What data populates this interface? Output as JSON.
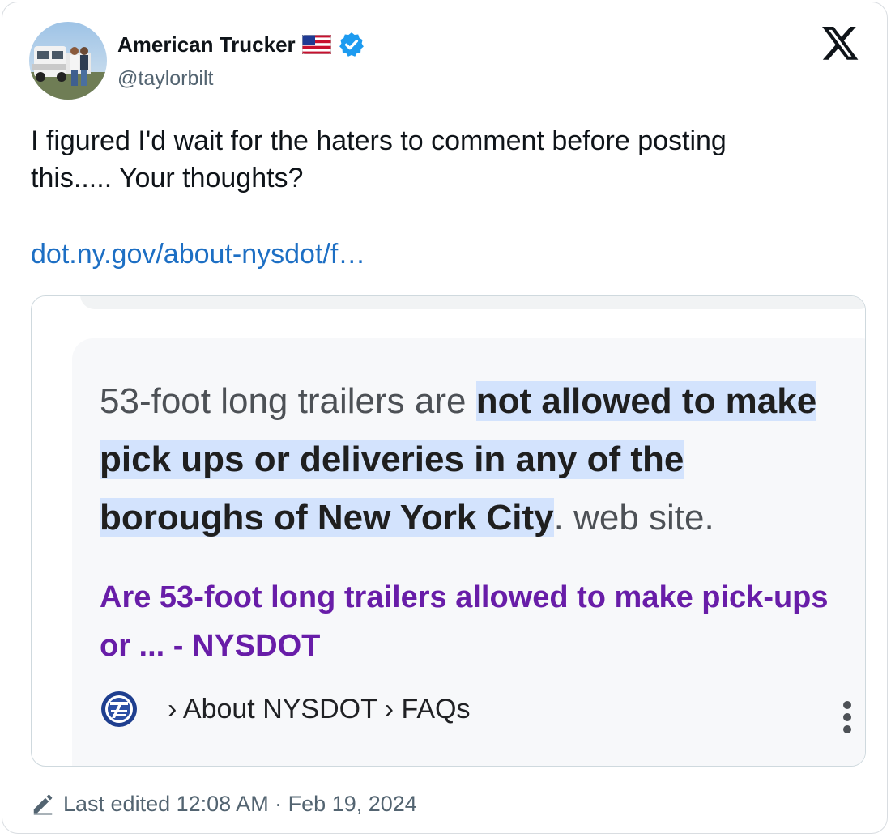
{
  "author": {
    "display_name": "American Trucker",
    "handle": "@taylorbilt",
    "flag_icon": "us-flag-emoji",
    "verified_icon": "verified-badge",
    "avatar_icon": "avatar-truck-photo"
  },
  "platform_logo": "x-logo",
  "tweet": {
    "text_line1": "I figured I'd wait for the haters to comment before posting",
    "text_line2": "this.....  Your thoughts?",
    "link": "dot.ny.gov/about-nysdot/f…"
  },
  "embedded_result": {
    "snippet_plain_start": "53-foot long trailers are ",
    "snippet_highlight": "not allowed to make pick ups or deliveries in any of the boroughs of New York City",
    "snippet_plain_end": ". web site.",
    "title": "Are 53-foot long trailers allowed to make pick-ups or ... - NYSDOT",
    "breadcrumb": "› About NYSDOT › FAQs",
    "site_icon": "nysdot-logo",
    "menu_icon": "more-vertical-icon"
  },
  "footer": {
    "edited_icon": "pencil-icon",
    "edited_text": "Last edited 12:08 AM · Feb 19, 2024"
  },
  "colors": {
    "link_blue": "#1d6fc4",
    "verified_blue": "#1d9bf0",
    "highlight_bg": "#d3e3fd",
    "result_title_purple": "#681da8",
    "muted_gray": "#536471"
  }
}
